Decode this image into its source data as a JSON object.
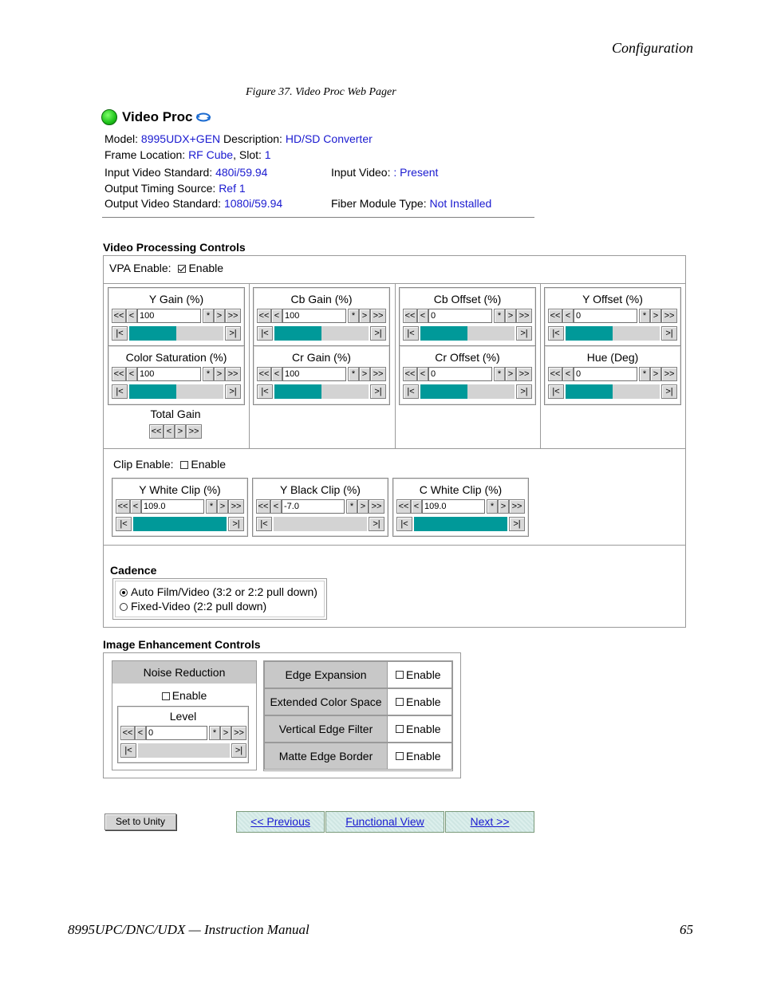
{
  "page": {
    "header_right": "Configuration",
    "figure_caption": "Figure 37.  Video Proc Web Pager",
    "footer_left": "8995UPC/DNC/UDX — Instruction Manual",
    "footer_right": "65"
  },
  "title": "Video Proc",
  "info": {
    "model_label": "Model:",
    "model_value": "8995UDX+GEN",
    "desc_label": "Description:",
    "desc_value": "HD/SD Converter",
    "frame_label": "Frame Location:",
    "frame_value": "RF Cube",
    "slot_label": ", Slot:",
    "slot_value": "1",
    "ivs_label": "Input Video Standard:",
    "ivs_value": "480i/59.94",
    "iv_label": "Input Video:",
    "iv_value": ": Present",
    "ots_label": "Output Timing Source:",
    "ots_value": "Ref 1",
    "ovs_label": "Output Video Standard:",
    "ovs_value": "1080i/59.94",
    "fmt_label": "Fiber Module Type:",
    "fmt_value": "Not Installed"
  },
  "vpc": {
    "title": "Video Processing Controls",
    "vpa_label": "VPA Enable:",
    "vpa_enable": "Enable",
    "vpa_checked": true,
    "controls": [
      {
        "label": "Y Gain (%)",
        "value": "100",
        "level": 0.5
      },
      {
        "label": "Cb Gain (%)",
        "value": "100",
        "level": 0.5
      },
      {
        "label": "Cb Offset (%)",
        "value": "0",
        "level": 0.5
      },
      {
        "label": "Y Offset (%)",
        "value": "0",
        "level": 0.5
      },
      {
        "label": "Color Saturation (%)",
        "value": "100",
        "level": 0.5
      },
      {
        "label": "Cr Gain (%)",
        "value": "100",
        "level": 0.5
      },
      {
        "label": "Cr Offset (%)",
        "value": "0",
        "level": 0.5
      },
      {
        "label": "Hue (Deg)",
        "value": "0",
        "level": 0.5
      }
    ],
    "total_gain": "Total Gain",
    "clip_label": "Clip Enable:",
    "clip_enable": "Enable",
    "clips": [
      {
        "label": "Y White Clip (%)",
        "value": "109.0",
        "level": 1.0
      },
      {
        "label": "Y Black Clip (%)",
        "value": "-7.0",
        "level": 0.0
      },
      {
        "label": "C White Clip (%)",
        "value": "109.0",
        "level": 1.0
      }
    ],
    "cadence_title": "Cadence",
    "cadence_opt1": "Auto Film/Video (3:2 or 2:2 pull down)",
    "cadence_opt2": "Fixed-Video (2:2 pull down)"
  },
  "iec": {
    "title": "Image Enhancement Controls",
    "noise_title": "Noise Reduction",
    "noise_enable": "Enable",
    "level_label": "Level",
    "level_value": "0",
    "rows": [
      {
        "label": "Edge Expansion",
        "enable": "Enable"
      },
      {
        "label": "Extended Color Space",
        "enable": "Enable"
      },
      {
        "label": "Vertical Edge Filter",
        "enable": "Enable"
      },
      {
        "label": "Matte Edge Border",
        "enable": "Enable"
      }
    ]
  },
  "buttons": {
    "unity": "Set to Unity",
    "prev": "<< Previous",
    "func": "Functional View",
    "next": "Next >>",
    "ff_back": "<<",
    "back": "<",
    "star": "*",
    "fwd": ">",
    "ff_fwd": ">>",
    "min": "|<",
    "max": ">|"
  },
  "colors": {
    "slider_fill": "#009999",
    "link": "#1a1ad0",
    "led": "#1ec21a"
  }
}
